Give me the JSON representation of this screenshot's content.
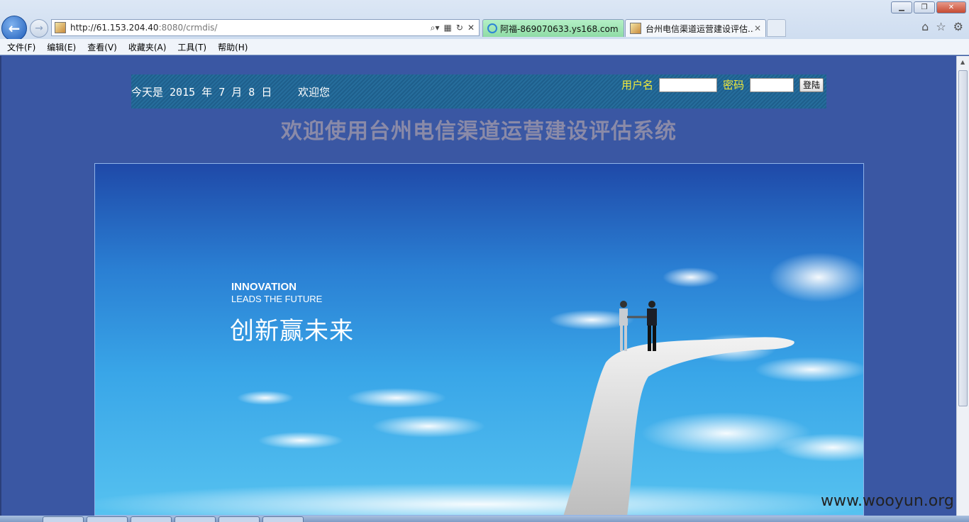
{
  "browser": {
    "url_prefix": "http://61.153.204.40",
    "url_suffix": ":8080/crmdis/",
    "tabs": [
      {
        "label": "阿福-869070633.ys168.com"
      },
      {
        "label": "台州电信渠道运营建设评估..."
      }
    ],
    "menu": [
      "文件(F)",
      "编辑(E)",
      "查看(V)",
      "收藏夹(A)",
      "工具(T)",
      "帮助(H)"
    ]
  },
  "header": {
    "date_text": "今天是 2015 年 7 月 8 日",
    "welcome_text": "欢迎您",
    "username_label": "用户名",
    "password_label": "密码",
    "login_button": "登陆"
  },
  "main": {
    "title": "欢迎使用台州电信渠道运营建设评估系统"
  },
  "banner": {
    "line1": "INNOVATION",
    "line2": "LEADS THE FUTURE",
    "line3": "创新赢未来"
  },
  "watermark": "www.wooyun.org",
  "colors": {
    "page_bg": "#3a57a3",
    "header_label": "#f3ea3a",
    "title_text": "#8a8aa8"
  }
}
